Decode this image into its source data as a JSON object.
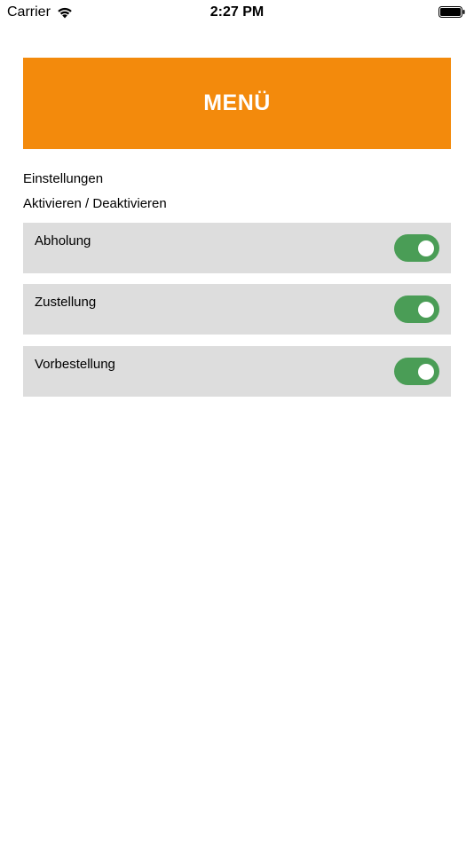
{
  "status_bar": {
    "carrier": "Carrier",
    "time": "2:27 PM",
    "wifi_icon": "wifi-icon",
    "battery_icon": "battery-icon"
  },
  "header": {
    "title": "MENÜ",
    "color": "#f38a0c"
  },
  "settings": {
    "section_title": "Einstellungen",
    "toggle_hint": "Aktivieren / Deaktivieren",
    "options": [
      {
        "label": "Abholung",
        "enabled": true
      },
      {
        "label": "Zustellung",
        "enabled": true
      },
      {
        "label": "Vorbestellung",
        "enabled": true
      }
    ],
    "toggle_on_color": "#4a9d56",
    "row_background": "#dddddd"
  }
}
